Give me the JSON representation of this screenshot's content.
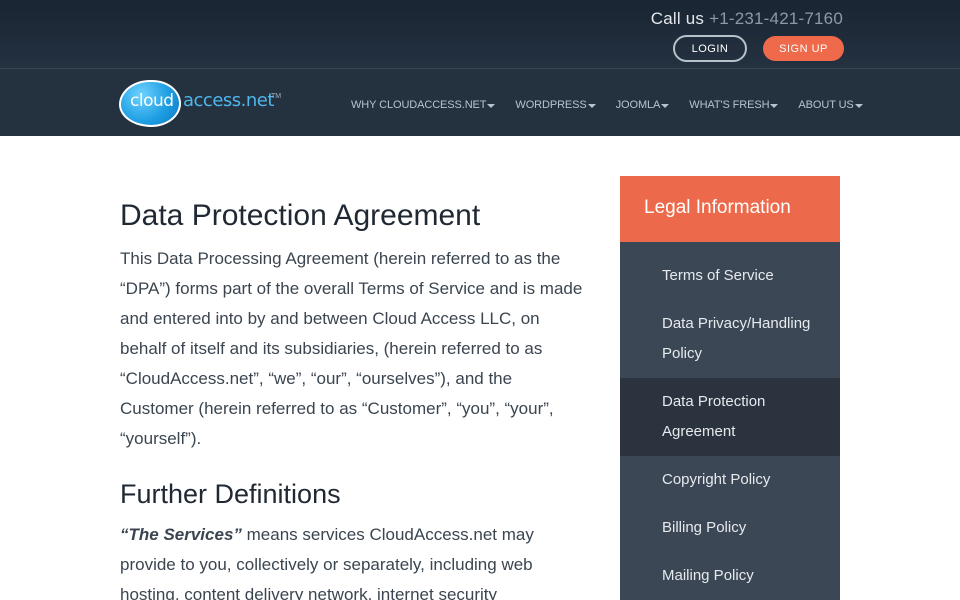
{
  "header": {
    "call_label": "Call us",
    "phone": "+1-231-421-7160",
    "login_label": "LOGIN",
    "signup_label": "SIGN UP"
  },
  "logo": {
    "cloud": "cloud",
    "access": "access.net",
    "tm": "TM",
    "icon": "cloud-bubble-icon"
  },
  "nav": {
    "items": [
      {
        "label": "WHY CLOUDACCESS.NET"
      },
      {
        "label": "WORDPRESS"
      },
      {
        "label": "JOOMLA"
      },
      {
        "label": "WHAT'S FRESH"
      },
      {
        "label": "ABOUT US"
      }
    ],
    "caret_icon": "caret-down-icon"
  },
  "main": {
    "title": "Data Protection Agreement",
    "intro": "This Data Processing Agreement (herein referred to as the “DPA”) forms part of the overall Terms of Service and is made and entered into by and between Cloud Access LLC, on behalf of itself and its subsidiaries, (herein referred to as “CloudAccess.net”, “we”, “our”, “ourselves”), and the Customer (herein referred to as “Customer”, “you”, “your”, “yourself”).",
    "section_title": "Further Definitions",
    "definition_term": "“The Services”",
    "definition_text": " means services CloudAccess.net may provide to you, collectively or separately, including web hosting, content delivery network, internet security"
  },
  "sidebar": {
    "title": "Legal Information",
    "items": [
      {
        "label": "Terms of Service",
        "active": false
      },
      {
        "label": "Data Privacy/Handling Policy",
        "active": false
      },
      {
        "label": "Data Protection Agreement",
        "active": true
      },
      {
        "label": "Copyright Policy",
        "active": false
      },
      {
        "label": "Billing Policy",
        "active": false
      },
      {
        "label": "Mailing Policy",
        "active": false
      }
    ]
  },
  "colors": {
    "accent": "#ec6a4b",
    "header_bg": "#24313f",
    "sidebar_bg": "#3b4754",
    "sidebar_active_bg": "#2a333e"
  }
}
